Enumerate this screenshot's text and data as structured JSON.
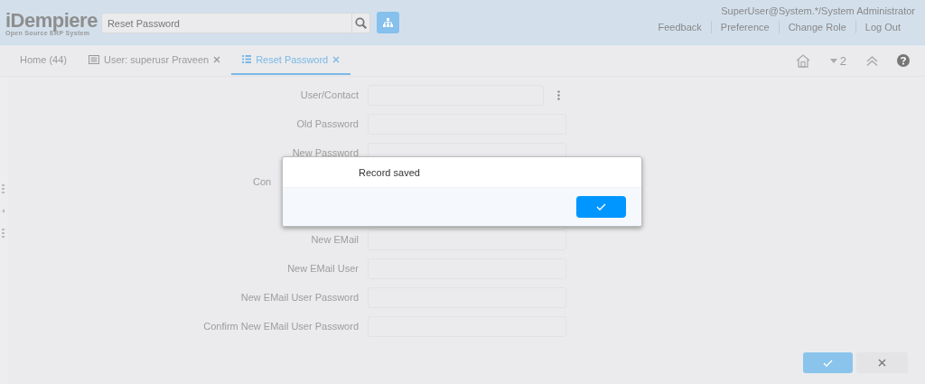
{
  "header": {
    "logo": "iDempiere",
    "tagline": "Open Source ERP System",
    "search": {
      "value": "Reset Password"
    },
    "user": "SuperUser@System.*/System Administrator",
    "links": [
      "Feedback",
      "Preference",
      "Change Role",
      "Log Out"
    ]
  },
  "tabs": [
    {
      "label": "Home (44)",
      "kind": "home",
      "selected": false,
      "closable": false
    },
    {
      "label": "User: superusr Praveen",
      "kind": "window",
      "selected": false,
      "closable": true
    },
    {
      "label": "Reset Password",
      "kind": "process",
      "selected": true,
      "closable": true
    }
  ],
  "toolbar": {
    "count": "2"
  },
  "form": {
    "fields": [
      {
        "label": "User/Contact",
        "kind": "lookup"
      },
      {
        "label": "Old Password",
        "kind": "text"
      },
      {
        "label": "New Password",
        "kind": "text"
      },
      {
        "label": "Con",
        "kind": "hidden",
        "cut_off": true
      },
      {
        "kind": "hidden"
      },
      {
        "label": "New EMail",
        "kind": "text"
      },
      {
        "label": "New EMail User",
        "kind": "text"
      },
      {
        "label": "New EMail User Password",
        "kind": "text"
      },
      {
        "label": "Confirm New EMail User Password",
        "kind": "text"
      }
    ]
  },
  "dialog": {
    "message": "Record saved"
  },
  "buttons": [
    {
      "kind": "ok"
    },
    {
      "kind": "cancel"
    }
  ]
}
